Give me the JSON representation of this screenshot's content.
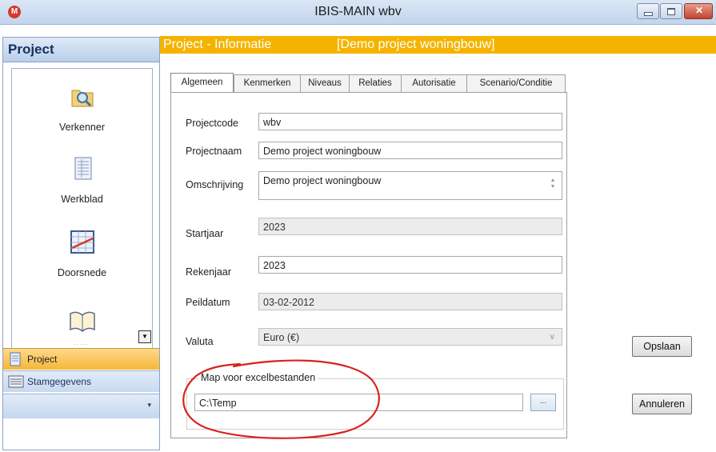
{
  "window": {
    "title": "IBIS-MAIN wbv",
    "app_icon_letter": "M",
    "controls": [
      "minimize",
      "maximize",
      "close"
    ]
  },
  "sidebar": {
    "header": "Project",
    "launcher": [
      {
        "label": "Verkenner",
        "icon": "folder-search-icon"
      },
      {
        "label": "Werkblad",
        "icon": "worksheet-icon"
      },
      {
        "label": "Doorsnede",
        "icon": "cross-section-chart-icon"
      },
      {
        "label": "",
        "icon": "book-icon"
      }
    ],
    "nav": [
      {
        "label": "Project",
        "icon": "project-document-icon",
        "active": true
      },
      {
        "label": "Stamgegevens",
        "icon": "master-data-icon",
        "active": false
      }
    ]
  },
  "header": {
    "title": "Project - Informatie",
    "project": "[Demo project woningbouw]",
    "color": "#f5b300"
  },
  "tabs": [
    "Algemeen",
    "Kenmerken",
    "Niveaus",
    "Relaties",
    "Autorisatie",
    "Scenario/Conditie"
  ],
  "active_tab": "Algemeen",
  "form": {
    "projectcode": {
      "label": "Projectcode",
      "value": "wbv"
    },
    "projectnaam": {
      "label": "Projectnaam",
      "value": "Demo project woningbouw"
    },
    "omschrijving": {
      "label": "Omschrijving",
      "value": "Demo project woningbouw"
    },
    "startjaar": {
      "label": "Startjaar",
      "value": "2023"
    },
    "rekenjaar": {
      "label": "Rekenjaar",
      "value": "2023"
    },
    "peildatum": {
      "label": "Peildatum",
      "value": "03-02-2012"
    },
    "valuta": {
      "label": "Valuta",
      "value": "Euro (€)"
    }
  },
  "excel_group": {
    "title": "Map voor excelbestanden",
    "path": "C:\\Temp",
    "browse_label": "..."
  },
  "buttons": {
    "save": "Opslaan",
    "cancel": "Annuleren"
  },
  "annotation_color": "#d9231f"
}
